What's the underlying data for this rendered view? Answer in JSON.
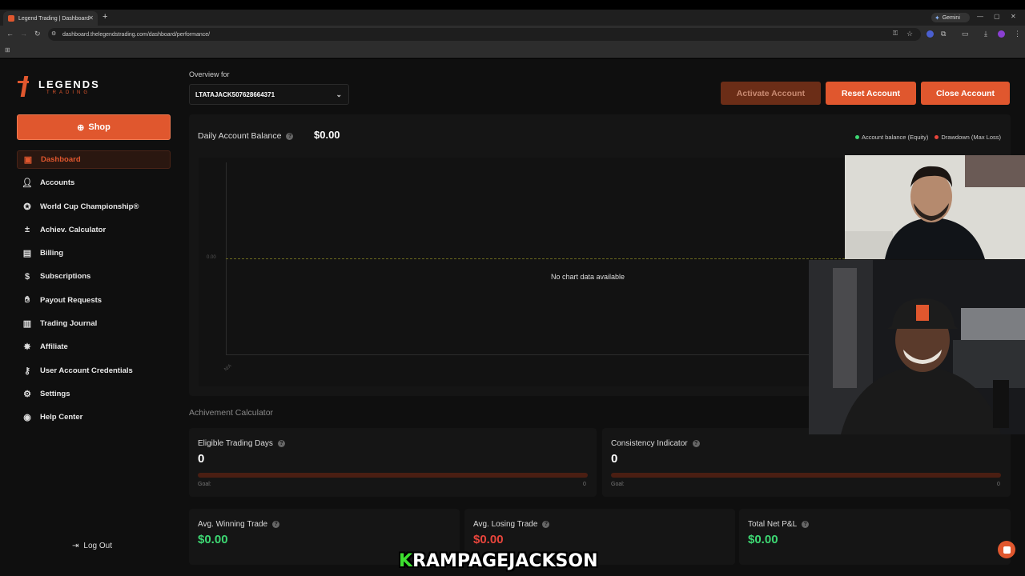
{
  "browser": {
    "tab_title": "Legend Trading | Dashboard",
    "url": "dashboard.thelegendstrading.com/dashboard/performance/",
    "gemini_label": "Gemini"
  },
  "brand": {
    "name": "LEGENDS",
    "sub": "TRADING",
    "accent": "#e0572e"
  },
  "sidebar": {
    "shop_label": "Shop",
    "items": [
      {
        "label": "Dashboard",
        "icon": "dashboard-icon"
      },
      {
        "label": "Accounts",
        "icon": "user-icon"
      },
      {
        "label": "World Cup Championship®",
        "icon": "trophy-icon"
      },
      {
        "label": "Achiev. Calculator",
        "icon": "calculator-icon"
      },
      {
        "label": "Billing",
        "icon": "document-icon"
      },
      {
        "label": "Subscriptions",
        "icon": "dollar-icon"
      },
      {
        "label": "Payout Requests",
        "icon": "hand-money-icon"
      },
      {
        "label": "Trading Journal",
        "icon": "book-icon"
      },
      {
        "label": "Affiliate",
        "icon": "badge-icon"
      },
      {
        "label": "User Account Credentials",
        "icon": "key-user-icon"
      },
      {
        "label": "Settings",
        "icon": "gear-icon"
      },
      {
        "label": "Help Center",
        "icon": "help-icon"
      }
    ],
    "logout_label": "Log Out"
  },
  "header": {
    "overview_label": "Overview for",
    "account_id": "LTATAJACK507628664371",
    "activate_label": "Activate Account",
    "reset_label": "Reset Account",
    "close_label": "Close Account"
  },
  "balance": {
    "title": "Daily Account Balance",
    "value": "$0.00",
    "legend_equity": "Account balance (Equity)",
    "legend_drawdown": "Drawdown (Max Loss)",
    "equity_color": "#3dd873",
    "drawdown_color": "#e8453c",
    "zero_label": "0.00",
    "x_label": "N/A",
    "no_data": "No chart data available"
  },
  "achievement": {
    "section_title": "Achivement Calculator",
    "eligible": {
      "label": "Eligible Trading Days",
      "value": "0",
      "goal_label": "Goal:",
      "goal_value": "0"
    },
    "consistency": {
      "label": "Consistency Indicator",
      "value": "0",
      "goal_label": "Goal:",
      "goal_value": "0"
    }
  },
  "stats": {
    "avg_win": {
      "label": "Avg. Winning Trade",
      "value": "$0.00"
    },
    "avg_loss": {
      "label": "Avg. Losing Trade",
      "value": "$0.00"
    },
    "net_pnl": {
      "label": "Total Net P&L",
      "value": "$0.00"
    }
  },
  "overlay": {
    "name_first": "K",
    "name_rest": "RAMPAGEJACKSON"
  }
}
